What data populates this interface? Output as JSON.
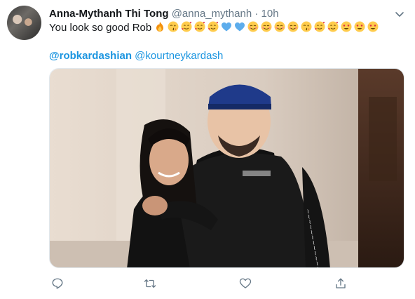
{
  "tweet": {
    "display_name": "Anna-Mythanh Thi Tong",
    "handle": "@anna_mythanh",
    "separator": "·",
    "time": "10h",
    "text": "You look so good Rob",
    "emoji_sequence": [
      "fire",
      "kiss",
      "hearts-smile",
      "hearts-smile",
      "hearts-smile",
      "blue-heart",
      "blue-heart",
      "blush",
      "blush",
      "blush",
      "blush",
      "kiss",
      "hearts-smile",
      "hearts-smile",
      "heart-eyes",
      "heart-eyes",
      "heart-eyes"
    ],
    "mentions": [
      "@robkardashian",
      "@kourtneykardash"
    ]
  },
  "actions": {
    "reply_icon": "reply-icon",
    "retweet_icon": "retweet-icon",
    "like_icon": "like-icon",
    "share_icon": "share-icon"
  },
  "colors": {
    "link": "#1b95e0",
    "secondary_text": "#657786",
    "icon": "#657786"
  }
}
